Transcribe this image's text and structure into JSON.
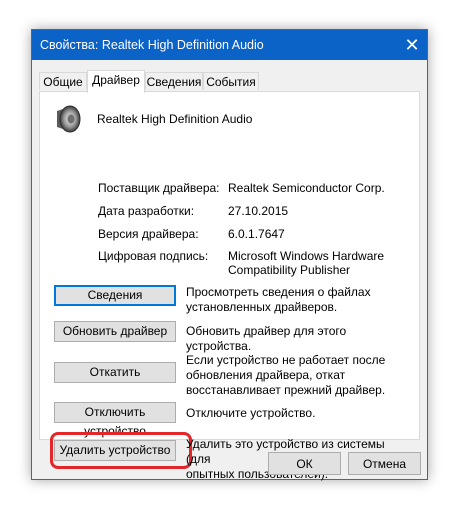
{
  "window": {
    "title": "Свойства: Realtek High Definition Audio",
    "close_glyph": "✕"
  },
  "tabs": [
    {
      "label": "Общие",
      "active": false
    },
    {
      "label": "Драйвер",
      "active": true
    },
    {
      "label": "Сведения",
      "active": false
    },
    {
      "label": "События",
      "active": false
    }
  ],
  "device": {
    "icon": "speaker-icon",
    "name": "Realtek High Definition Audio"
  },
  "info": [
    {
      "label": "Поставщик драйвера:",
      "value": "Realtek Semiconductor Corp."
    },
    {
      "label": "Дата разработки:",
      "value": "27.10.2015"
    },
    {
      "label": "Версия драйвера:",
      "value": "6.0.1.7647"
    },
    {
      "label": "Цифровая подпись:",
      "value_line1": "Microsoft Windows Hardware",
      "value_line2": "Compatibility Publisher"
    }
  ],
  "actions": [
    {
      "label": "Сведения",
      "desc_line1": "Просмотреть сведения о файлах",
      "desc_line2": "установленных драйверов."
    },
    {
      "label": "Обновить драйвер",
      "desc_line1": "Обновить драйвер для этого устройства."
    },
    {
      "label": "Откатить",
      "desc_line1": "Если устройство не работает после",
      "desc_line2": "обновления драйвера, откат",
      "desc_line3": "восстанавливает прежний драйвер."
    },
    {
      "label": "Отключить устройство",
      "desc_line1": "Отключите устройство."
    },
    {
      "label": "Удалить устройство",
      "desc_line1": "Удалить это устройство из системы (для",
      "desc_line2": "опытных пользователей)."
    }
  ],
  "footer": {
    "ok_label": "ОК",
    "cancel_label": "Отмена"
  },
  "colors": {
    "titlebar": "#0b62c7",
    "highlight": "#e3262a",
    "focus": "#0078d7"
  }
}
